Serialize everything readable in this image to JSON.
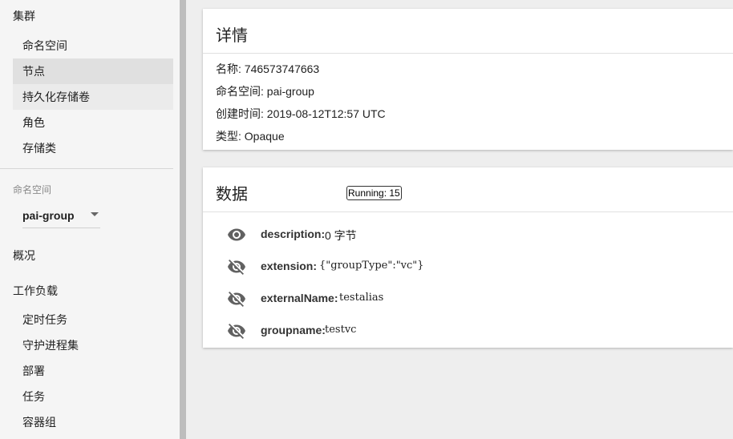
{
  "sidebar": {
    "cluster_heading": "集群",
    "cluster_items": [
      {
        "label": "命名空间"
      },
      {
        "label": "节点"
      },
      {
        "label": "持久化存储卷"
      },
      {
        "label": "角色"
      },
      {
        "label": "存储类"
      }
    ],
    "namespace_label": "命名空间",
    "namespace_value": "pai-group",
    "overview": "概况",
    "workloads_heading": "工作负载",
    "workload_items": [
      {
        "label": "定时任务"
      },
      {
        "label": "守护进程集"
      },
      {
        "label": "部署"
      },
      {
        "label": "任务"
      },
      {
        "label": "容器组"
      }
    ]
  },
  "details": {
    "title": "详情",
    "name": "名称: 746573747663",
    "namespace": "命名空间: pai-group",
    "created": "创建时间: 2019-08-12T12:57 UTC",
    "type": "类型: Opaque"
  },
  "data_card": {
    "title": "数据",
    "badge": "Running: 15",
    "rows": [
      {
        "key": "description:",
        "value": "0 字节",
        "icon": "eye-icon"
      },
      {
        "key": "extension:",
        "value": "{\"groupType\":\"vc\"}",
        "icon": "eye-off-icon"
      },
      {
        "key": "externalName:",
        "value": "testalias",
        "icon": "eye-off-icon"
      },
      {
        "key": "groupname:",
        "value": "testvc",
        "icon": "eye-off-icon"
      }
    ]
  },
  "colors": {
    "sidebar_bg": "#f5f5f5",
    "page_bg": "#eeeeee",
    "active_item_bg": "#e0e0e0",
    "icon_color": "#616161"
  }
}
